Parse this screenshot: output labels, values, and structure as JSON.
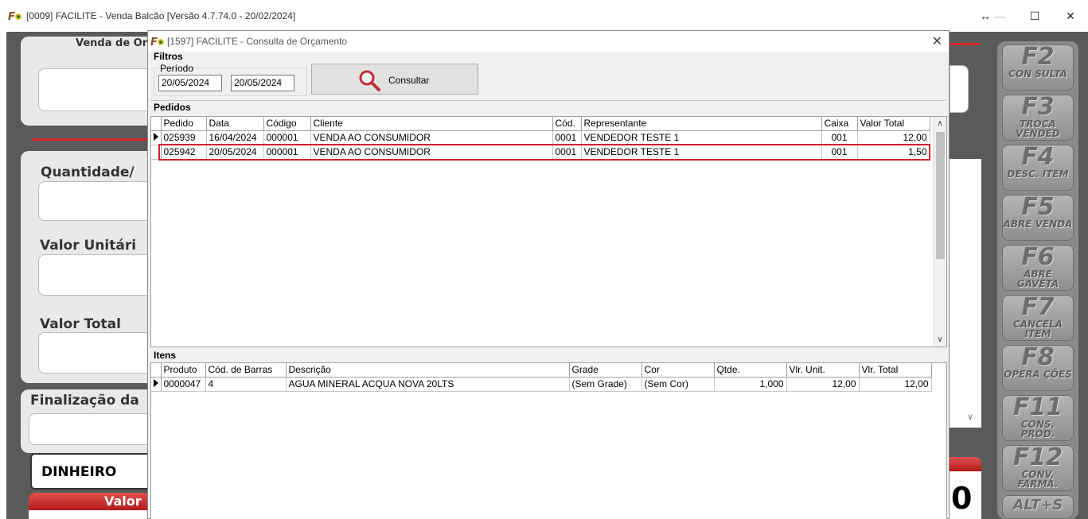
{
  "main_window": {
    "title": "[0009] FACILITE - Venda Balcão [Versão 4.7.74.0 - 20/02/2024]",
    "controls": {
      "restore": "↔",
      "minimize": "—",
      "maximize": "☐",
      "close": "✕"
    },
    "background": {
      "venda_label": "Venda de Orç",
      "quantidade_label": "Quantidade/",
      "valor_unitario_label": "Valor Unitári",
      "valor_total_label": "Valor Total",
      "finalizacao_label": "Finalização da",
      "payment_method": "DINHEIRO",
      "valor_label": "Valor",
      "big_digit": "0"
    },
    "function_keys": [
      {
        "key": "F2",
        "label": "CON SULTA"
      },
      {
        "key": "F3",
        "label": "TROCA VENDED"
      },
      {
        "key": "F4",
        "label": "DESC. ITEM"
      },
      {
        "key": "F5",
        "label": "ABRE VENDA"
      },
      {
        "key": "F6",
        "label": "ABRE GAVETA"
      },
      {
        "key": "F7",
        "label": "CANCELA ITEM"
      },
      {
        "key": "F8",
        "label": "OPERA ÇÕES"
      },
      {
        "key": "F11",
        "label": "CONS. PROD."
      },
      {
        "key": "F12",
        "label": "CONV. FARMÁ."
      },
      {
        "key": "ALT+S",
        "label": ""
      }
    ]
  },
  "dialog": {
    "title": "[1597] FACILITE - Consulta de Orçamento",
    "close": "✕",
    "filtros_label": "Filtros",
    "periodo_label": "Período",
    "date_from": "20/05/2024",
    "date_to": "20/05/2024",
    "consultar_label": "Consultar",
    "pedidos_label": "Pedidos",
    "pedidos_columns": [
      "Pedido",
      "Data",
      "Código",
      "Cliente",
      "Cód.",
      "Representante",
      "Caixa",
      "Valor Total"
    ],
    "pedidos_rows": [
      [
        "025939",
        "16/04/2024",
        "000001",
        "VENDA AO CONSUMIDOR",
        "0001",
        "VENDEDOR TESTE 1",
        "001",
        "12,00"
      ],
      [
        "025942",
        "20/05/2024",
        "000001",
        "VENDA AO CONSUMIDOR",
        "0001",
        "VENDEDOR TESTE 1",
        "001",
        "1,50"
      ]
    ],
    "itens_label": "Itens",
    "itens_columns": [
      "Produto",
      "Cód. de Barras",
      "Descrição",
      "Grade",
      "Cor",
      "Qtde.",
      "Vlr. Unit.",
      "Vlr. Total"
    ],
    "itens_rows": [
      [
        "0000047",
        "4",
        "AGUA MINERAL ACQUA NOVA 20LTS",
        "(Sem Grade)",
        "(Sem Cor)",
        "1,000",
        "12,00",
        "12,00"
      ]
    ],
    "colors": {
      "highlight": "#d0202a",
      "accent_red": "#d12a2a"
    }
  }
}
